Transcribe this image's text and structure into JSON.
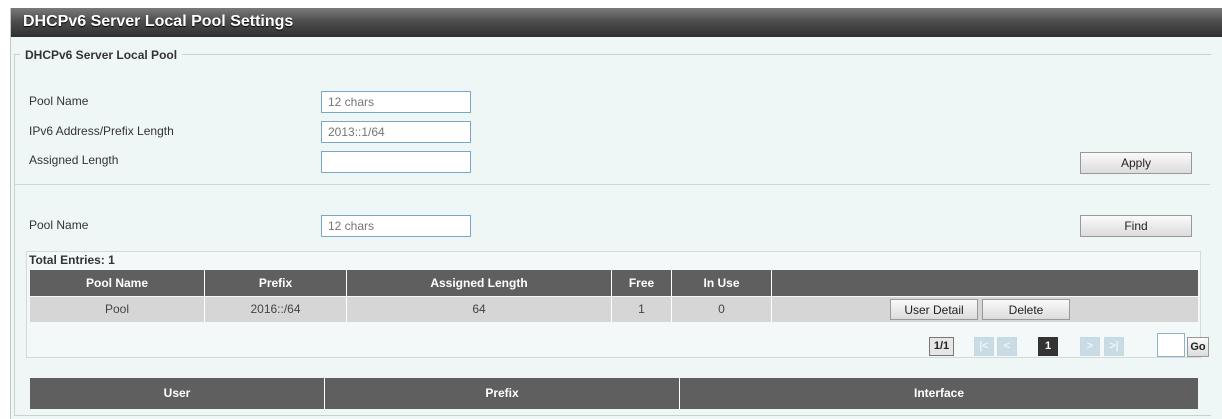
{
  "page": {
    "title": "DHCPv6 Server Local Pool Settings",
    "section_legend": "DHCPv6 Server Local Pool"
  },
  "form": {
    "pool_name_label": "Pool Name",
    "pool_name_placeholder": "12 chars",
    "ipv6_label": "IPv6 Address/Prefix Length",
    "ipv6_placeholder": "2013::1/64",
    "assigned_length_label": "Assigned Length",
    "assigned_length_value": "",
    "apply_label": "Apply"
  },
  "find": {
    "pool_name_label": "Pool Name",
    "pool_name_placeholder": "12 chars",
    "find_label": "Find"
  },
  "table": {
    "total_entries": "Total Entries: 1",
    "headers": [
      "Pool Name",
      "Prefix",
      "Assigned Length",
      "Free",
      "In Use"
    ],
    "rows": [
      {
        "pool_name": "Pool",
        "prefix": "2016::/64",
        "assigned_length": "64",
        "free": "1",
        "in_use": "0",
        "user_detail_label": "User Detail",
        "delete_label": "Delete"
      }
    ]
  },
  "pagination": {
    "page_indicator": "1/1",
    "first": "|<",
    "prev": "<",
    "current": "1",
    "next": ">",
    "last": ">|",
    "go_label": "Go"
  },
  "user_table": {
    "headers": [
      "User",
      "Prefix",
      "Interface"
    ]
  }
}
